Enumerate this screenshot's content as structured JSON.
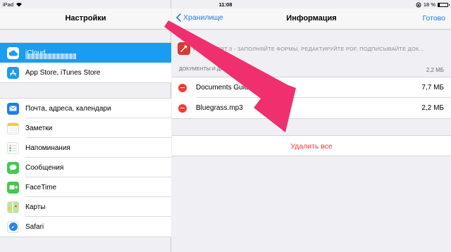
{
  "status_bar": {
    "device": "iPad",
    "time": "11:08",
    "battery": "18 %",
    "battery_level": 0.18
  },
  "left_pane": {
    "title": "Настройки",
    "group1": [
      {
        "label": "iCloud",
        "icon": "icloud-icon",
        "color": "#ffffff",
        "selected": true
      },
      {
        "label": "App Store, iTunes Store",
        "icon": "app-store-icon",
        "color": "#1a9df0"
      }
    ],
    "group2": [
      {
        "label": "Почта, адреса, календари",
        "icon": "mail-icon",
        "color": "#1e7cf0"
      },
      {
        "label": "Заметки",
        "icon": "notes-icon",
        "color": "#f5cf35"
      },
      {
        "label": "Напоминания",
        "icon": "reminders-icon",
        "color": "#ffffff"
      },
      {
        "label": "Сообщения",
        "icon": "messages-icon",
        "color": "#43c94c"
      },
      {
        "label": "FaceTime",
        "icon": "facetime-icon",
        "color": "#43c94c"
      },
      {
        "label": "Карты",
        "icon": "maps-icon",
        "color": "#7fc46a"
      },
      {
        "label": "Safari",
        "icon": "safari-icon",
        "color": "#1e86f0"
      }
    ]
  },
  "right_pane": {
    "back_label": "Хранилище",
    "title": "Информация",
    "done_label": "Готово",
    "app_name": "PDF EXPERT 5 - ЗАПОЛНЯЙТЕ ФОРМЫ, РЕДАКТИРУЙТЕ PDF, ПОДПИСЫВАЙТЕ ДОК...",
    "section_header": "ДОКУМЕНТЫ И ДАННЫЕ",
    "section_size": "2,2 МБ",
    "files": [
      {
        "name": "Documents Guide.guide",
        "size": "7,7 МБ"
      },
      {
        "name": "Bluegrass.mp3",
        "size": "2,2 МБ"
      }
    ],
    "delete_all_label": "Удалить все"
  },
  "colors": {
    "accent": "#1a7cf6",
    "destructive": "#f33a31",
    "arrow": "#f0306e",
    "selection": "#1a9df0"
  }
}
